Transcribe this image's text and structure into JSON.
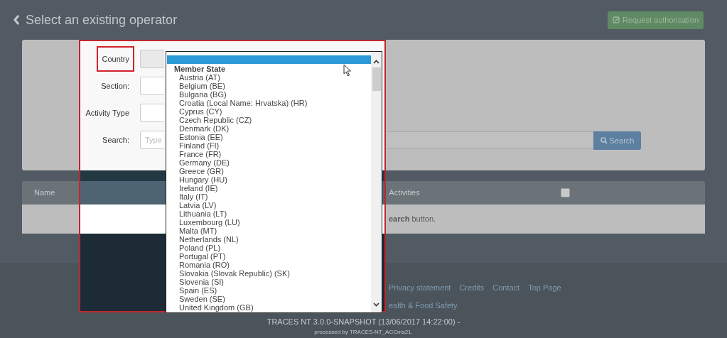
{
  "header": {
    "title": "Select an existing operator",
    "button": "Request authorisation"
  },
  "form": {
    "fields": [
      {
        "label": "Country",
        "highlighted": true
      },
      {
        "label": "Section:",
        "highlighted": false
      },
      {
        "label": "Activity Type",
        "highlighted": false
      },
      {
        "label": "Search:",
        "highlighted": false,
        "placeholder": "Type"
      }
    ],
    "search_button": "Search"
  },
  "country_dropdown": {
    "options": [
      {
        "kind": "blank",
        "selected": true
      },
      {
        "kind": "group",
        "label": "Member State"
      },
      {
        "kind": "option",
        "label": "Austria (AT)",
        "selected": false
      },
      {
        "kind": "option",
        "label": "Belgium (BE)",
        "selected": false
      },
      {
        "kind": "option",
        "label": "Bulgaria (BG)",
        "selected": false
      },
      {
        "kind": "option",
        "label": "Croatia (Local Name: Hrvatska) (HR)",
        "selected": false
      },
      {
        "kind": "option",
        "label": "Cyprus (CY)",
        "selected": false
      },
      {
        "kind": "option",
        "label": "Czech Republic (CZ)",
        "selected": false
      },
      {
        "kind": "option",
        "label": "Denmark (DK)",
        "selected": false
      },
      {
        "kind": "option",
        "label": "Estonia (EE)",
        "selected": false
      },
      {
        "kind": "option",
        "label": "Finland (FI)",
        "selected": false
      },
      {
        "kind": "option",
        "label": "France (FR)",
        "selected": false
      },
      {
        "kind": "option",
        "label": "Germany (DE)",
        "selected": false
      },
      {
        "kind": "option",
        "label": "Greece (GR)",
        "selected": false
      },
      {
        "kind": "option",
        "label": "Hungary (HU)",
        "selected": false
      },
      {
        "kind": "option",
        "label": "Ireland (IE)",
        "selected": false
      },
      {
        "kind": "option",
        "label": "Italy (IT)",
        "selected": false
      },
      {
        "kind": "option",
        "label": "Latvia (LV)",
        "selected": false
      },
      {
        "kind": "option",
        "label": "Lithuania (LT)",
        "selected": false
      },
      {
        "kind": "option",
        "label": "Luxembourg (LU)",
        "selected": false
      },
      {
        "kind": "option",
        "label": "Malta (MT)",
        "selected": false
      },
      {
        "kind": "option",
        "label": "Netherlands (NL)",
        "selected": false
      },
      {
        "kind": "option",
        "label": "Poland (PL)",
        "selected": false
      },
      {
        "kind": "option",
        "label": "Portugal (PT)",
        "selected": false
      },
      {
        "kind": "option",
        "label": "Romania (RO)",
        "selected": false
      },
      {
        "kind": "option",
        "label": "Slovakia (Slovak Republic) (SK)",
        "selected": false
      },
      {
        "kind": "option",
        "label": "Slovenia (SI)",
        "selected": false
      },
      {
        "kind": "option",
        "label": "Spain (ES)",
        "selected": false
      },
      {
        "kind": "option",
        "label": "Sweden (SE)",
        "selected": false
      },
      {
        "kind": "option",
        "label": "United Kingdom (GB)",
        "selected": false
      }
    ]
  },
  "table": {
    "columns": [
      "Name",
      "Activities"
    ],
    "select_all_checked": false,
    "empty_message": "**earch** button."
  },
  "footer": {
    "links": [
      "Privacy statement",
      "Credits",
      "Contact",
      "Top Page"
    ],
    "note": "ealth & Food Safety.",
    "version": "TRACES NT 3.0.0-SNAPSHOT (13/06/2017 14:22:00) -",
    "processed_by": "processed by TRACES-NT_ACCms21."
  }
}
